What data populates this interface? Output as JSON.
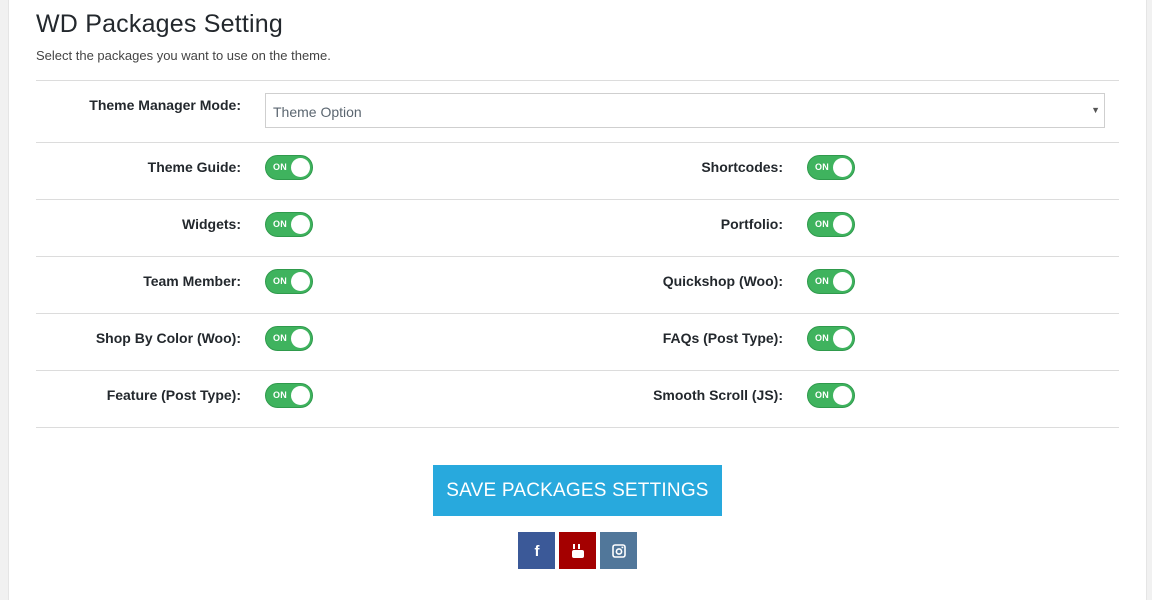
{
  "header": {
    "title": "WD Packages Setting",
    "subtitle": "Select the packages you want to use on the theme."
  },
  "theme_manager": {
    "label": "Theme Manager Mode:",
    "value": "Theme Option"
  },
  "toggle_on_text": "ON",
  "packages": {
    "theme_guide": "Theme Guide:",
    "shortcodes": "Shortcodes:",
    "widgets": "Widgets:",
    "portfolio": "Portfolio:",
    "team_member": "Team Member:",
    "quickshop": "Quickshop (Woo):",
    "shop_by_color": "Shop By Color (Woo):",
    "faqs": "FAQs (Post Type):",
    "feature": "Feature (Post Type):",
    "smooth_scroll": "Smooth Scroll (JS):"
  },
  "save_button": "SAVE PACKAGES SETTINGS",
  "social": [
    "facebook-icon",
    "youtube-icon",
    "instagram-icon"
  ],
  "colors": {
    "toggle_on": "#3fb35e",
    "save_button": "#28a9dd",
    "facebook": "#3b5998",
    "youtube": "#a40000",
    "instagram": "#51779a"
  }
}
